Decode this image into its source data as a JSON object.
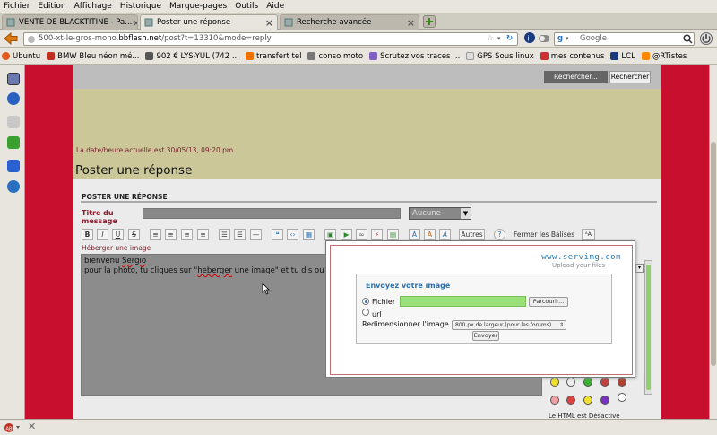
{
  "menu": [
    "Fichier",
    "Edition",
    "Affichage",
    "Historique",
    "Marque-pages",
    "Outils",
    "Aide"
  ],
  "tabs": [
    {
      "label": "VENTE DE BLACKTITINE - Pa..."
    },
    {
      "label": "Poster une réponse"
    },
    {
      "label": "Recherche avancée"
    }
  ],
  "nav": {
    "url_prefix": "500-xt-le-gros-mono.",
    "url_domain": "bbflash.net",
    "url_suffix": "/post?t=13310&mode=reply",
    "search_placeholder": "Google"
  },
  "bookmarks": [
    {
      "label": "Ubuntu",
      "color": "#e05a1c"
    },
    {
      "label": "BMW Bleu néon mé...",
      "color": "#c03020"
    },
    {
      "label": "902 € LYS-YUL (742 ...",
      "color": "#555555"
    },
    {
      "label": "transfert tel",
      "color": "#f07000"
    },
    {
      "label": "conso moto",
      "color": "#777777"
    },
    {
      "label": "Scrutez vos traces ...",
      "color": "#8060c0"
    },
    {
      "label": "GPS Sous linux",
      "color": "#dddddd"
    },
    {
      "label": "mes contenus",
      "color": "#cc3030"
    },
    {
      "label": "LCL",
      "color": "#1a3a80"
    },
    {
      "label": "@RTistes",
      "color": "#ff8800"
    }
  ],
  "forum": {
    "search_input": "Rechercher...",
    "search_button": "Rechercher",
    "datetime": "La date/heure actuelle est 30/05/13, 09:20 pm",
    "page_title": "Poster une réponse",
    "section_label": "POSTER UNE RÉPONSE",
    "title_label_1": "Titre du",
    "title_label_2": "message",
    "icon_select": "Aucune",
    "toolbar_autres": "Autres",
    "toolbar_fermer": "Fermer les Balises",
    "host_link": "Héberger une image",
    "editor_line1_a": "bienvenu ",
    "editor_line1_b": "Sergio",
    "editor_line2_a": "pour la photo, tu cliques sur \"",
    "editor_line2_b": "heberger",
    "editor_line2_c": " une image\" et tu dis ou",
    "html_note": "Le HTML est Désactivé"
  },
  "popup": {
    "logo_a": "www.",
    "logo_b": "servimg",
    "logo_c": ".com",
    "logo_sub": "Upload your files",
    "title": "Envoyez votre image",
    "file_label": "Fichier",
    "browse": "Parcourir...",
    "url_label": "url",
    "resize_label": "Redimensionner l'image",
    "resize_value": "800 px de largeur (pour les forums)",
    "send": "Envoyer"
  }
}
